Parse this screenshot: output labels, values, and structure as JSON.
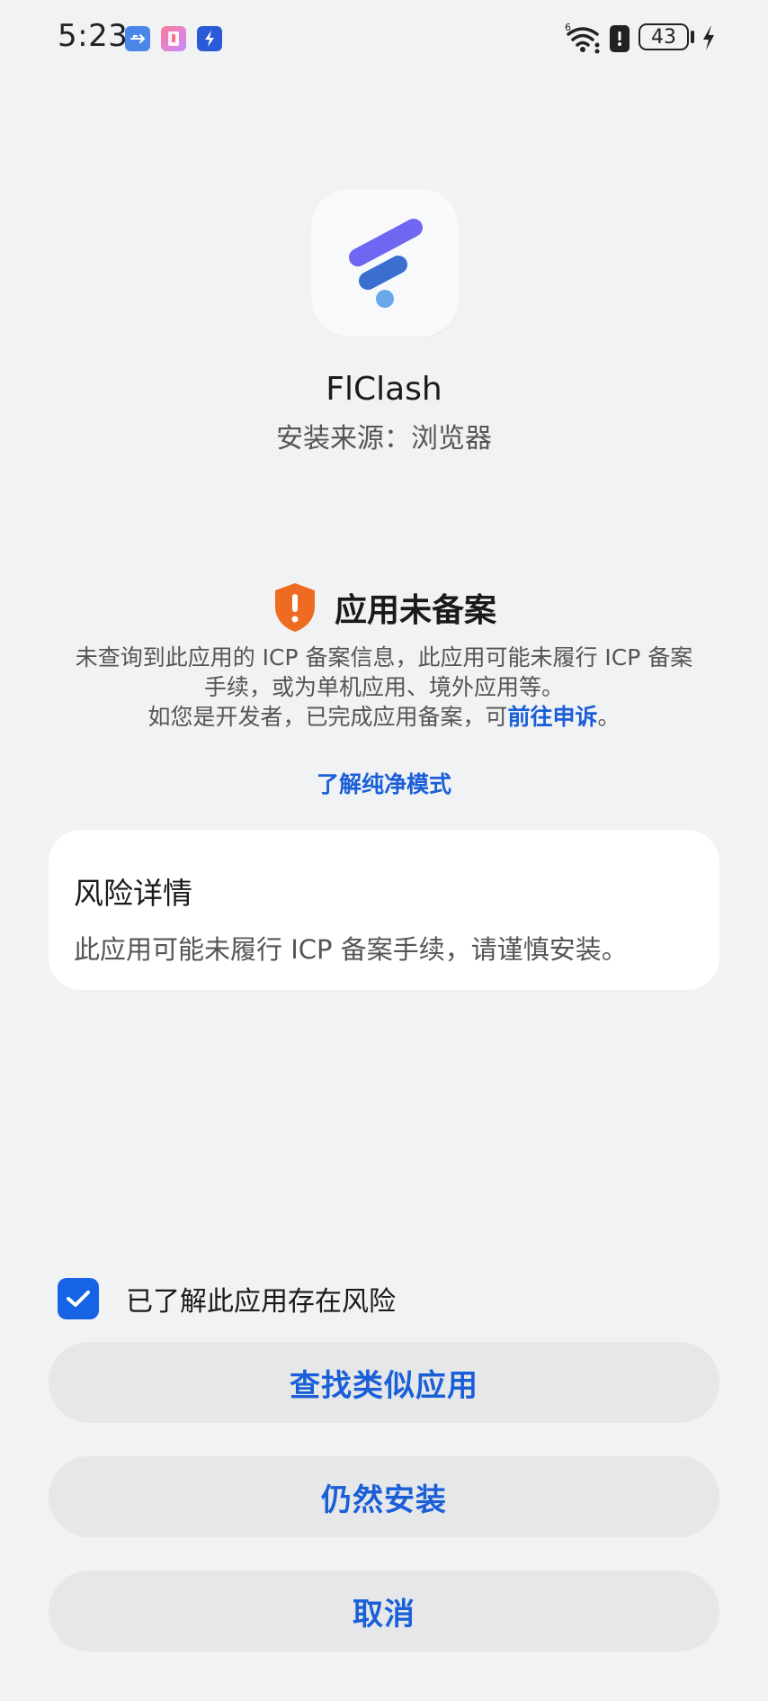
{
  "status_bar": {
    "time": "5:23",
    "battery_level": "43",
    "wifi_label": "6",
    "icons": [
      "usb-icon",
      "book-icon",
      "bolt-icon",
      "wifi-icon",
      "alert-icon",
      "battery-icon",
      "charging-icon"
    ]
  },
  "app": {
    "name": "FlClash",
    "source": "安装来源：浏览器"
  },
  "warning": {
    "title": "应用未备案",
    "desc_line1": "未查询到此应用的 ICP 备案信息，此应用可能未履行 ICP 备案",
    "desc_line2": "手续，或为单机应用、境外应用等。",
    "desc_line3_prefix": "如您是开发者，已完成应用备案，可",
    "desc_link": "前往申诉",
    "desc_line3_suffix": "。",
    "learn_more": "了解纯净模式"
  },
  "risk": {
    "title": "风险详情",
    "text": "此应用可能未履行 ICP 备案手续，请谨慎安装。"
  },
  "acknowledge": {
    "label": "已了解此应用存在风险",
    "checked": true
  },
  "buttons": {
    "find_similar": "查找类似应用",
    "install_anyway": "仍然安装",
    "cancel": "取消"
  },
  "colors": {
    "accent": "#1a5fd8",
    "warning": "#ee6b22",
    "background": "#f1f2f4",
    "logo_purple": "#6f66f2",
    "logo_blue": "#3a6fd0",
    "logo_light": "#6aa8ec"
  }
}
